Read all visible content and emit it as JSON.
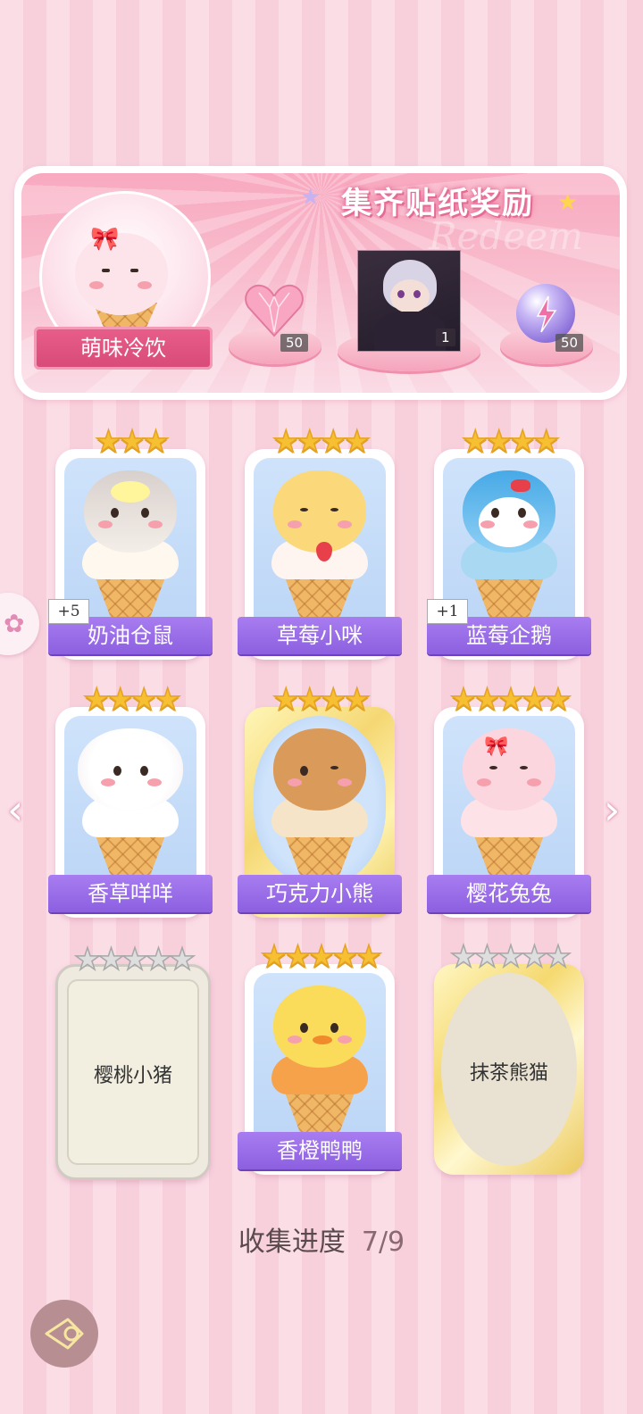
{
  "banner": {
    "title": "集齐贴纸奖励",
    "watermark": "Redeem",
    "set_name": "萌味冷饮",
    "rewards": [
      {
        "icon": "pink-heart-gem-icon",
        "count": "50"
      },
      {
        "icon": "character-portrait",
        "count": "1"
      },
      {
        "icon": "energy-orb-icon",
        "count": "50"
      }
    ]
  },
  "cards": [
    {
      "name": "奶油仓鼠",
      "stars": 3,
      "max_stars": 3,
      "bonus": "+5",
      "collected": true
    },
    {
      "name": "草莓小咪",
      "stars": 4,
      "max_stars": 4,
      "bonus": "",
      "collected": true
    },
    {
      "name": "蓝莓企鹅",
      "stars": 4,
      "max_stars": 4,
      "bonus": "+1",
      "collected": true
    },
    {
      "name": "香草咩咩",
      "stars": 4,
      "max_stars": 4,
      "bonus": "",
      "collected": true
    },
    {
      "name": "巧克力小熊",
      "stars": 4,
      "max_stars": 4,
      "bonus": "",
      "collected": true
    },
    {
      "name": "樱花兔兔",
      "stars": 5,
      "max_stars": 5,
      "bonus": "",
      "collected": true
    },
    {
      "name": "樱桃小猪",
      "stars": 0,
      "max_stars": 5,
      "bonus": "",
      "collected": false
    },
    {
      "name": "香橙鸭鸭",
      "stars": 5,
      "max_stars": 5,
      "bonus": "",
      "collected": true
    },
    {
      "name": "抹茶熊猫",
      "stars": 0,
      "max_stars": 5,
      "bonus": "",
      "collected": false
    }
  ],
  "progress": {
    "label": "收集进度",
    "value": "7/9"
  },
  "colors": {
    "accent_pink": "#e85e8a",
    "nameplate_purple": "#9a6ee8",
    "star_gold": "#f6c032"
  }
}
